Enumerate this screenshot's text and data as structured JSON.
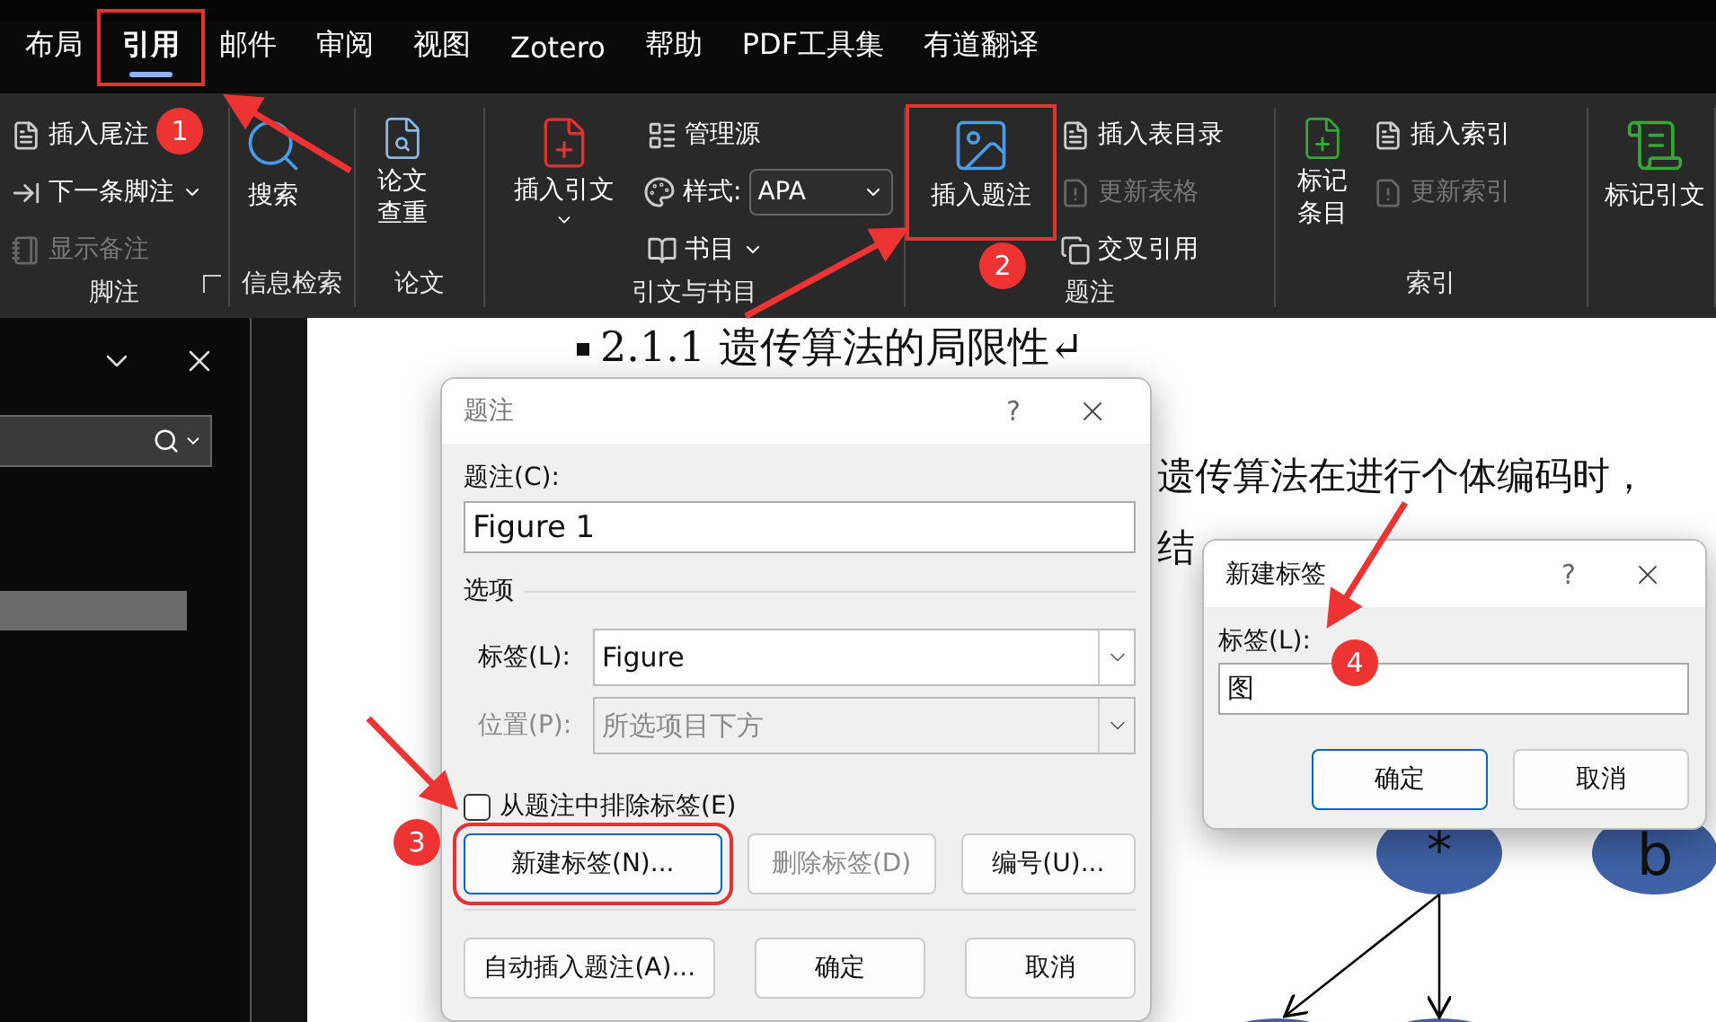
{
  "menu_tabs": [
    {
      "label": "布局",
      "selected": false,
      "highlighted": false
    },
    {
      "label": "引用",
      "selected": true,
      "highlighted": true
    },
    {
      "label": "邮件",
      "selected": false,
      "highlighted": false
    },
    {
      "label": "审阅",
      "selected": false,
      "highlighted": false
    },
    {
      "label": "视图",
      "selected": false,
      "highlighted": false
    },
    {
      "label": "Zotero",
      "selected": false,
      "highlighted": false
    },
    {
      "label": "帮助",
      "selected": false,
      "highlighted": false
    },
    {
      "label": "PDF工具集",
      "selected": false,
      "highlighted": false
    },
    {
      "label": "有道翻译",
      "selected": false,
      "highlighted": false
    }
  ],
  "ribbon": {
    "groups": [
      {
        "label": "脚注",
        "launcher": true,
        "columns": [
          {
            "kind": "stack",
            "items": [
              {
                "kind": "button",
                "label": "插入尾注",
                "disabled": false,
                "dropdown": false
              },
              {
                "kind": "button",
                "label": "下一条脚注",
                "disabled": false,
                "dropdown": true
              },
              {
                "kind": "button",
                "label": "显示备注",
                "disabled": true,
                "dropdown": false
              }
            ]
          }
        ]
      },
      {
        "label": "信息检索",
        "launcher": false,
        "columns": [
          {
            "kind": "large",
            "label": "搜索",
            "dropdown": false
          }
        ]
      },
      {
        "label": "论文",
        "launcher": false,
        "columns": [
          {
            "kind": "large",
            "label": "论文查重",
            "dropdown": false
          }
        ]
      },
      {
        "label": "引文与书目",
        "launcher": false,
        "columns": [
          {
            "kind": "large",
            "label": "插入引文",
            "dropdown": true
          },
          {
            "kind": "stack",
            "items": [
              {
                "kind": "button",
                "label": "管理源",
                "disabled": false,
                "dropdown": false
              },
              {
                "kind": "select",
                "label": "样式:",
                "value": "APA"
              },
              {
                "kind": "button",
                "label": "书目",
                "disabled": false,
                "dropdown": true
              }
            ]
          }
        ]
      },
      {
        "label": "题注",
        "launcher": false,
        "columns": [
          {
            "kind": "large",
            "label": "插入题注",
            "dropdown": false,
            "highlighted": true
          },
          {
            "kind": "stack",
            "items": [
              {
                "kind": "button",
                "label": "插入表目录",
                "disabled": false,
                "dropdown": false
              },
              {
                "kind": "button",
                "label": "更新表格",
                "disabled": true,
                "dropdown": false
              },
              {
                "kind": "button",
                "label": "交叉引用",
                "disabled": false,
                "dropdown": false
              }
            ]
          }
        ]
      },
      {
        "label": "索引",
        "launcher": false,
        "columns": [
          {
            "kind": "large",
            "label": "标记条目",
            "dropdown": false
          },
          {
            "kind": "stack",
            "items": [
              {
                "kind": "button",
                "label": "插入索引",
                "disabled": false,
                "dropdown": false
              },
              {
                "kind": "button",
                "label": "更新索引",
                "disabled": true,
                "dropdown": false
              }
            ]
          }
        ]
      },
      {
        "columns": [
          {
            "kind": "large",
            "label": "标记引文",
            "dropdown": false
          }
        ]
      }
    ]
  },
  "document": {
    "heading": "2.1.1 遗传算法的局限性↵",
    "lines": [
      "遗传算法在进行个体编码时，",
      "结"
    ],
    "diagram": {
      "nodes": [
        {
          "label": "*"
        },
        {
          "label": "b"
        }
      ]
    }
  },
  "caption_dialog": {
    "title": "题注",
    "help": "?",
    "caption_label": "题注(C):",
    "caption_value": "Figure 1",
    "section": "选项",
    "rows": [
      {
        "label": "标签(L):",
        "value": "Figure",
        "disabled": false
      },
      {
        "label": "位置(P):",
        "value": "所选项目下方",
        "disabled": true
      }
    ],
    "exclude_label": {
      "label": "从题注中排除标签(E)",
      "checked": false
    },
    "buttons": [
      {
        "label": "新建标签(N)...",
        "disabled": false,
        "highlighted": true
      },
      {
        "label": "删除标签(D)",
        "disabled": true,
        "highlighted": false
      },
      {
        "label": "编号(U)...",
        "disabled": false,
        "highlighted": false
      }
    ],
    "footer_buttons": [
      "自动插入题注(A)...",
      "确定",
      "取消"
    ]
  },
  "new_label_dialog": {
    "title": "新建标签",
    "help": "?",
    "field_label": "标签(L):",
    "value": "图",
    "buttons": [
      "确定",
      "取消"
    ]
  },
  "annotations": [
    {
      "label": "1"
    },
    {
      "label": "2"
    },
    {
      "label": "3"
    },
    {
      "label": "4"
    }
  ]
}
